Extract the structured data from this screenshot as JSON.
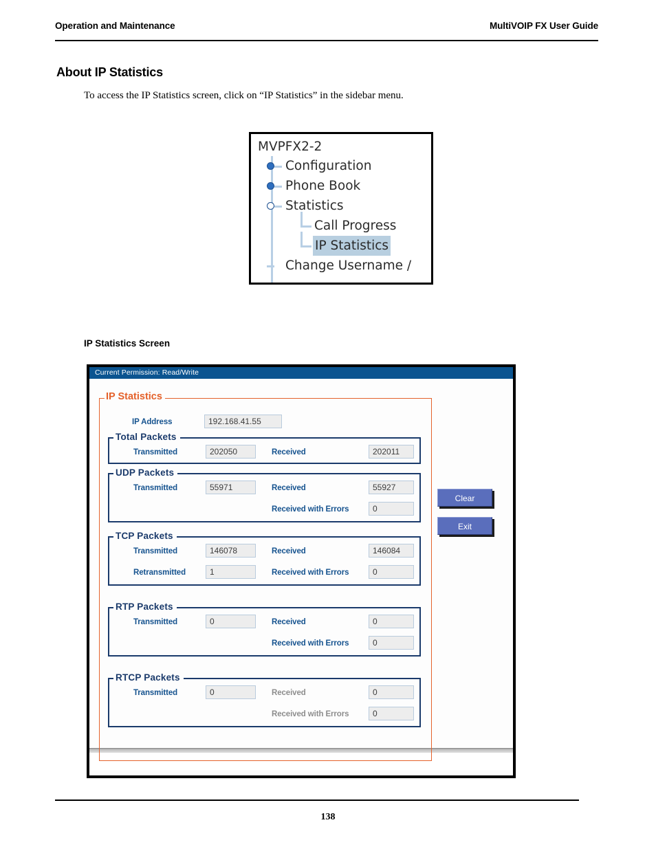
{
  "page_header": {
    "left": "Operation and Maintenance",
    "right": "MultiVOIP FX User Guide"
  },
  "section": {
    "title": "About IP Statistics",
    "intro": "To access the IP Statistics screen, click on “IP Statistics” in the sidebar menu."
  },
  "tree": {
    "root": "MVPFX2-2",
    "items": [
      {
        "label": "Configuration",
        "level": 1,
        "node": "collapsed",
        "selected": false
      },
      {
        "label": "Phone Book",
        "level": 1,
        "node": "collapsed",
        "selected": false
      },
      {
        "label": "Statistics",
        "level": 1,
        "node": "expanded",
        "selected": false
      },
      {
        "label": "Call Progress",
        "level": 2,
        "node": "leaf",
        "selected": false
      },
      {
        "label": "IP Statistics",
        "level": 2,
        "node": "leaf",
        "selected": true
      },
      {
        "label": "Change Username /",
        "level": 1,
        "node": "leaf-stub",
        "selected": false
      }
    ]
  },
  "screen_caption": "IP Statistics Screen",
  "dialog": {
    "titlebar": "Current Permission:  Read/Write",
    "panel_title": "IP Statistics",
    "ip_address": {
      "label": "IP Address",
      "value": "192.168.41.55"
    },
    "groups": [
      {
        "title": "Total Packets",
        "rows": [
          {
            "label": "Transmitted",
            "value": "202050",
            "label2": "Received",
            "value2": "202011",
            "dim": false,
            "dim2": false
          }
        ]
      },
      {
        "title": "UDP Packets",
        "rows": [
          {
            "label": "Transmitted",
            "value": "55971",
            "label2": "Received",
            "value2": "55927",
            "dim": false,
            "dim2": false
          },
          {
            "label": "",
            "value": "",
            "label2": "Received with Errors",
            "value2": "0",
            "dim": false,
            "dim2": false
          }
        ]
      },
      {
        "title": "TCP Packets",
        "rows": [
          {
            "label": "Transmitted",
            "value": "146078",
            "label2": "Received",
            "value2": "146084",
            "dim": false,
            "dim2": false
          },
          {
            "label": "Retransmitted",
            "value": "1",
            "label2": "Received with Errors",
            "value2": "0",
            "dim": false,
            "dim2": false
          }
        ]
      },
      {
        "title": "RTP Packets",
        "rows": [
          {
            "label": "Transmitted",
            "value": "0",
            "label2": "Received",
            "value2": "0",
            "dim": false,
            "dim2": false
          },
          {
            "label": "",
            "value": "",
            "label2": "Received with Errors",
            "value2": "0",
            "dim": false,
            "dim2": false
          }
        ]
      },
      {
        "title": "RTCP Packets",
        "rows": [
          {
            "label": "Transmitted",
            "value": "0",
            "label2": "Received",
            "value2": "0",
            "dim": false,
            "dim2": true
          },
          {
            "label": "",
            "value": "",
            "label2": "Received with Errors",
            "value2": "0",
            "dim": false,
            "dim2": true
          }
        ]
      }
    ],
    "buttons": [
      {
        "label": "Clear"
      },
      {
        "label": "Exit"
      }
    ]
  },
  "footer": {
    "page_number": "138"
  },
  "colors": {
    "titlebar_blue": "#0b5490",
    "panel_orange": "#e4612a",
    "group_navy": "#1a3a6b",
    "label_blue": "#16538f",
    "button_blue": "#5a6ebc",
    "dim_grey": "#8d8d8d",
    "tree_select": "#b8cfe0"
  }
}
